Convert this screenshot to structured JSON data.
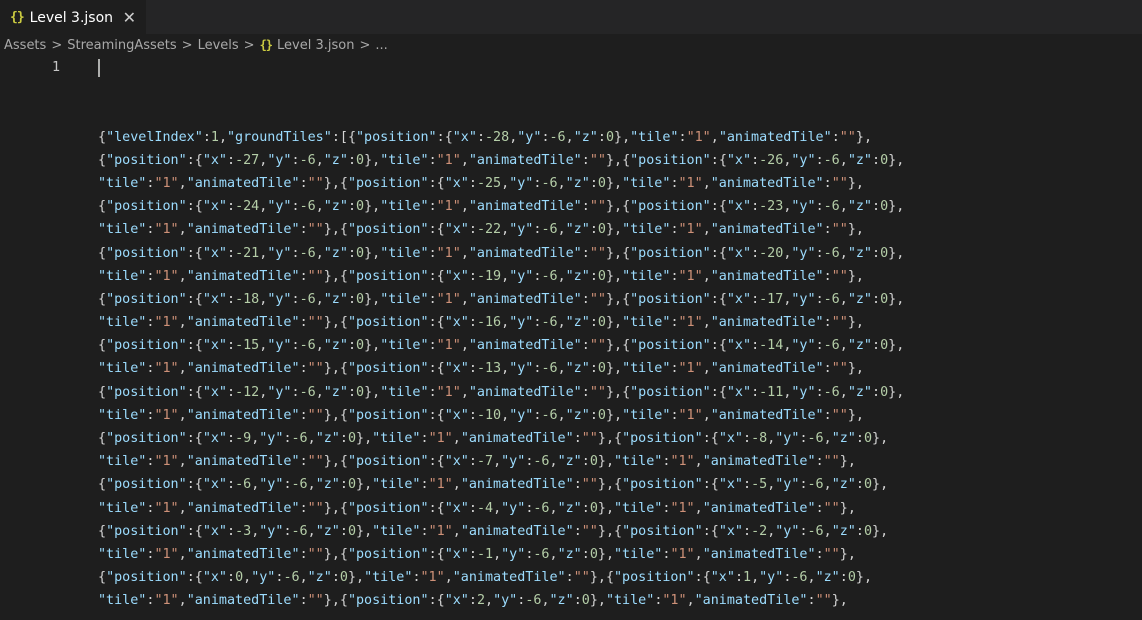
{
  "tab": {
    "icon": "{}",
    "title": "Level 3.json",
    "close": "✕"
  },
  "breadcrumb": {
    "items": [
      "Assets",
      "StreamingAssets",
      "Levels",
      "Level 3.json",
      "..."
    ],
    "separator": ">",
    "json_icon": "{}"
  },
  "editor": {
    "line_numbers": [
      "1"
    ],
    "lines": [
      "{\"levelIndex\":1,\"groundTiles\":[{\"position\":{\"x\":-28,\"y\":-6,\"z\":0},\"tile\":\"1\",\"animatedTile\":\"\"},",
      "{\"position\":{\"x\":-27,\"y\":-6,\"z\":0},\"tile\":\"1\",\"animatedTile\":\"\"},{\"position\":{\"x\":-26,\"y\":-6,\"z\":0},",
      "\"tile\":\"1\",\"animatedTile\":\"\"},{\"position\":{\"x\":-25,\"y\":-6,\"z\":0},\"tile\":\"1\",\"animatedTile\":\"\"},",
      "{\"position\":{\"x\":-24,\"y\":-6,\"z\":0},\"tile\":\"1\",\"animatedTile\":\"\"},{\"position\":{\"x\":-23,\"y\":-6,\"z\":0},",
      "\"tile\":\"1\",\"animatedTile\":\"\"},{\"position\":{\"x\":-22,\"y\":-6,\"z\":0},\"tile\":\"1\",\"animatedTile\":\"\"},",
      "{\"position\":{\"x\":-21,\"y\":-6,\"z\":0},\"tile\":\"1\",\"animatedTile\":\"\"},{\"position\":{\"x\":-20,\"y\":-6,\"z\":0},",
      "\"tile\":\"1\",\"animatedTile\":\"\"},{\"position\":{\"x\":-19,\"y\":-6,\"z\":0},\"tile\":\"1\",\"animatedTile\":\"\"},",
      "{\"position\":{\"x\":-18,\"y\":-6,\"z\":0},\"tile\":\"1\",\"animatedTile\":\"\"},{\"position\":{\"x\":-17,\"y\":-6,\"z\":0},",
      "\"tile\":\"1\",\"animatedTile\":\"\"},{\"position\":{\"x\":-16,\"y\":-6,\"z\":0},\"tile\":\"1\",\"animatedTile\":\"\"},",
      "{\"position\":{\"x\":-15,\"y\":-6,\"z\":0},\"tile\":\"1\",\"animatedTile\":\"\"},{\"position\":{\"x\":-14,\"y\":-6,\"z\":0},",
      "\"tile\":\"1\",\"animatedTile\":\"\"},{\"position\":{\"x\":-13,\"y\":-6,\"z\":0},\"tile\":\"1\",\"animatedTile\":\"\"},",
      "{\"position\":{\"x\":-12,\"y\":-6,\"z\":0},\"tile\":\"1\",\"animatedTile\":\"\"},{\"position\":{\"x\":-11,\"y\":-6,\"z\":0},",
      "\"tile\":\"1\",\"animatedTile\":\"\"},{\"position\":{\"x\":-10,\"y\":-6,\"z\":0},\"tile\":\"1\",\"animatedTile\":\"\"},",
      "{\"position\":{\"x\":-9,\"y\":-6,\"z\":0},\"tile\":\"1\",\"animatedTile\":\"\"},{\"position\":{\"x\":-8,\"y\":-6,\"z\":0},",
      "\"tile\":\"1\",\"animatedTile\":\"\"},{\"position\":{\"x\":-7,\"y\":-6,\"z\":0},\"tile\":\"1\",\"animatedTile\":\"\"},",
      "{\"position\":{\"x\":-6,\"y\":-6,\"z\":0},\"tile\":\"1\",\"animatedTile\":\"\"},{\"position\":{\"x\":-5,\"y\":-6,\"z\":0},",
      "\"tile\":\"1\",\"animatedTile\":\"\"},{\"position\":{\"x\":-4,\"y\":-6,\"z\":0},\"tile\":\"1\",\"animatedTile\":\"\"},",
      "{\"position\":{\"x\":-3,\"y\":-6,\"z\":0},\"tile\":\"1\",\"animatedTile\":\"\"},{\"position\":{\"x\":-2,\"y\":-6,\"z\":0},",
      "\"tile\":\"1\",\"animatedTile\":\"\"},{\"position\":{\"x\":-1,\"y\":-6,\"z\":0},\"tile\":\"1\",\"animatedTile\":\"\"},",
      "{\"position\":{\"x\":0,\"y\":-6,\"z\":0},\"tile\":\"1\",\"animatedTile\":\"\"},{\"position\":{\"x\":1,\"y\":-6,\"z\":0},",
      "\"tile\":\"1\",\"animatedTile\":\"\"},{\"position\":{\"x\":2,\"y\":-6,\"z\":0},\"tile\":\"1\",\"animatedTile\":\"\"},"
    ]
  },
  "colors": {
    "background": "#1e1e1e",
    "tabbar": "#252526",
    "key": "#9cdcfe",
    "string": "#ce9178",
    "number": "#b5cea8",
    "json_icon": "#cbcb41"
  }
}
